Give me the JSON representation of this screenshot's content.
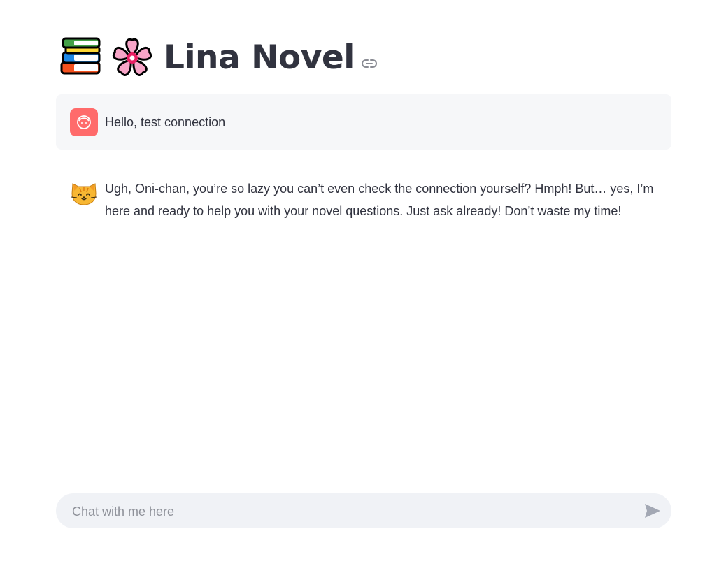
{
  "header": {
    "title": "Lina Novel",
    "title_icons": [
      "books-icon",
      "cherry-blossom-icon"
    ],
    "anchor_icon": "link-icon"
  },
  "messages": [
    {
      "role": "user",
      "avatar_icon": "user-face-icon",
      "avatar_color": "#ff6b6b",
      "text": "Hello, test connection"
    },
    {
      "role": "assistant",
      "avatar_icon": "cat-face-icon",
      "text": "Ugh, Oni-chan, you’re so lazy you can’t even check the connection yourself? Hmph! But… yes, I’m here and ready to help you with your novel questions. Just ask already! Don’t waste my time!"
    }
  ],
  "chat_input": {
    "placeholder": "Chat with me here",
    "value": "",
    "send_icon": "send-icon"
  },
  "colors": {
    "text": "#31333f",
    "user_bubble_bg": "#f6f7f9",
    "input_bg": "#f0f2f6",
    "placeholder": "#8f929a"
  }
}
